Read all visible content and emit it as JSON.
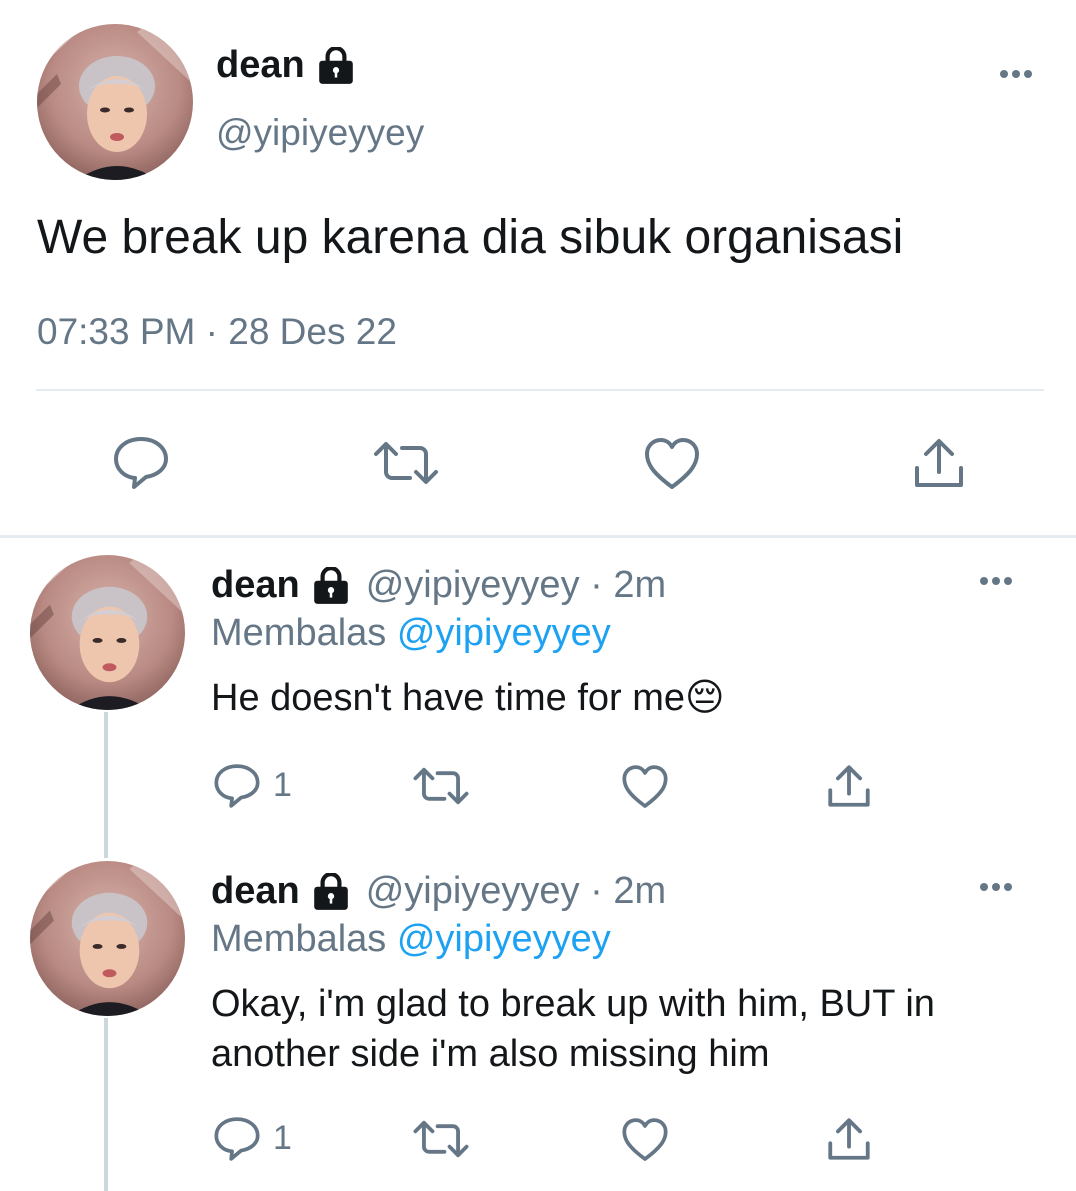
{
  "main_tweet": {
    "display_name": "dean",
    "lock_icon": "lock-icon",
    "handle": "@yipiyeyyey",
    "text": "We break up karena dia sibuk organisasi",
    "timestamp": "07:33 PM · 28 Des 22",
    "actions": [
      "reply-icon",
      "retweet-icon",
      "like-icon",
      "share-icon"
    ]
  },
  "replies": [
    {
      "display_name": "dean",
      "handle_time": "@yipiyeyyey · 2m",
      "replying_prefix": "Membalas",
      "replying_mention": "@yipiyeyyey",
      "text": "He doesn't have time for me",
      "emoji": "😔",
      "reply_count": "1"
    },
    {
      "display_name": "dean",
      "handle_time": "@yipiyeyyey · 2m",
      "replying_prefix": "Membalas",
      "replying_mention": "@yipiyeyyey",
      "text_line1": "Okay, i'm glad to break up with him, BUT in",
      "text_line2": "another side i'm also missing him",
      "reply_count": "1"
    }
  ],
  "colors": {
    "primary_text": "#14171a",
    "secondary_text": "#657786",
    "link": "#1da1f2",
    "divider": "#e6ecf0",
    "thread_line": "#ccd6dd"
  }
}
